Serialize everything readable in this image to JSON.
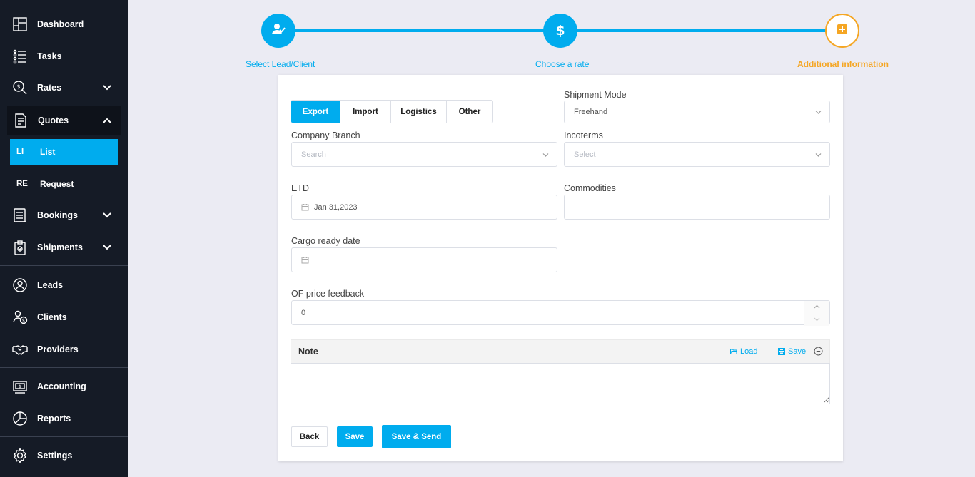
{
  "sidebar": {
    "items": [
      {
        "label": "Dashboard",
        "icon": "dashboard-icon"
      },
      {
        "label": "Tasks",
        "icon": "tasks-icon"
      },
      {
        "label": "Rates",
        "icon": "rates-icon"
      },
      {
        "label": "Quotes",
        "icon": "quotes-icon"
      },
      {
        "label": "Bookings",
        "icon": "bookings-icon"
      },
      {
        "label": "Shipments",
        "icon": "shipments-icon"
      },
      {
        "label": "Leads",
        "icon": "leads-icon"
      },
      {
        "label": "Clients",
        "icon": "clients-icon"
      },
      {
        "label": "Providers",
        "icon": "providers-icon"
      },
      {
        "label": "Accounting",
        "icon": "accounting-icon"
      },
      {
        "label": "Reports",
        "icon": "reports-icon"
      },
      {
        "label": "Settings",
        "icon": "settings-icon"
      }
    ],
    "quotes_submenu": [
      {
        "abbr": "LI",
        "label": "List",
        "active": true
      },
      {
        "abbr": "RE",
        "label": "Request",
        "active": false
      }
    ]
  },
  "stepper": {
    "steps": [
      {
        "label": "Select Lead/Client",
        "icon": "user-check-icon",
        "state": "done"
      },
      {
        "label": "Choose a rate",
        "icon": "dollar-icon",
        "state": "done"
      },
      {
        "label": "Additional information",
        "icon": "plus-square-icon",
        "state": "current"
      }
    ]
  },
  "form": {
    "type_options": [
      "Export",
      "Import",
      "Logistics",
      "Other"
    ],
    "type_selected": "Export",
    "shipment_mode": {
      "label": "Shipment Mode",
      "value": "Freehand"
    },
    "company_branch": {
      "label": "Company Branch",
      "placeholder": "Search"
    },
    "incoterms": {
      "label": "Incoterms",
      "placeholder": "Select"
    },
    "etd": {
      "label": "ETD",
      "value": "Jan 31,2023"
    },
    "commodities": {
      "label": "Commodities",
      "value": ""
    },
    "cargo_ready_date": {
      "label": "Cargo ready date",
      "value": ""
    },
    "of_price_feedback": {
      "label": "OF price feedback",
      "value": "0"
    },
    "note": {
      "title": "Note",
      "load_label": "Load",
      "save_label": "Save",
      "value": ""
    }
  },
  "buttons": {
    "back": "Back",
    "save": "Save",
    "save_send": "Save & Send"
  },
  "colors": {
    "sidebar_bg": "#151b26",
    "accent": "#00acee",
    "current_step": "#f5a623",
    "page_bg": "#ebebf3"
  }
}
